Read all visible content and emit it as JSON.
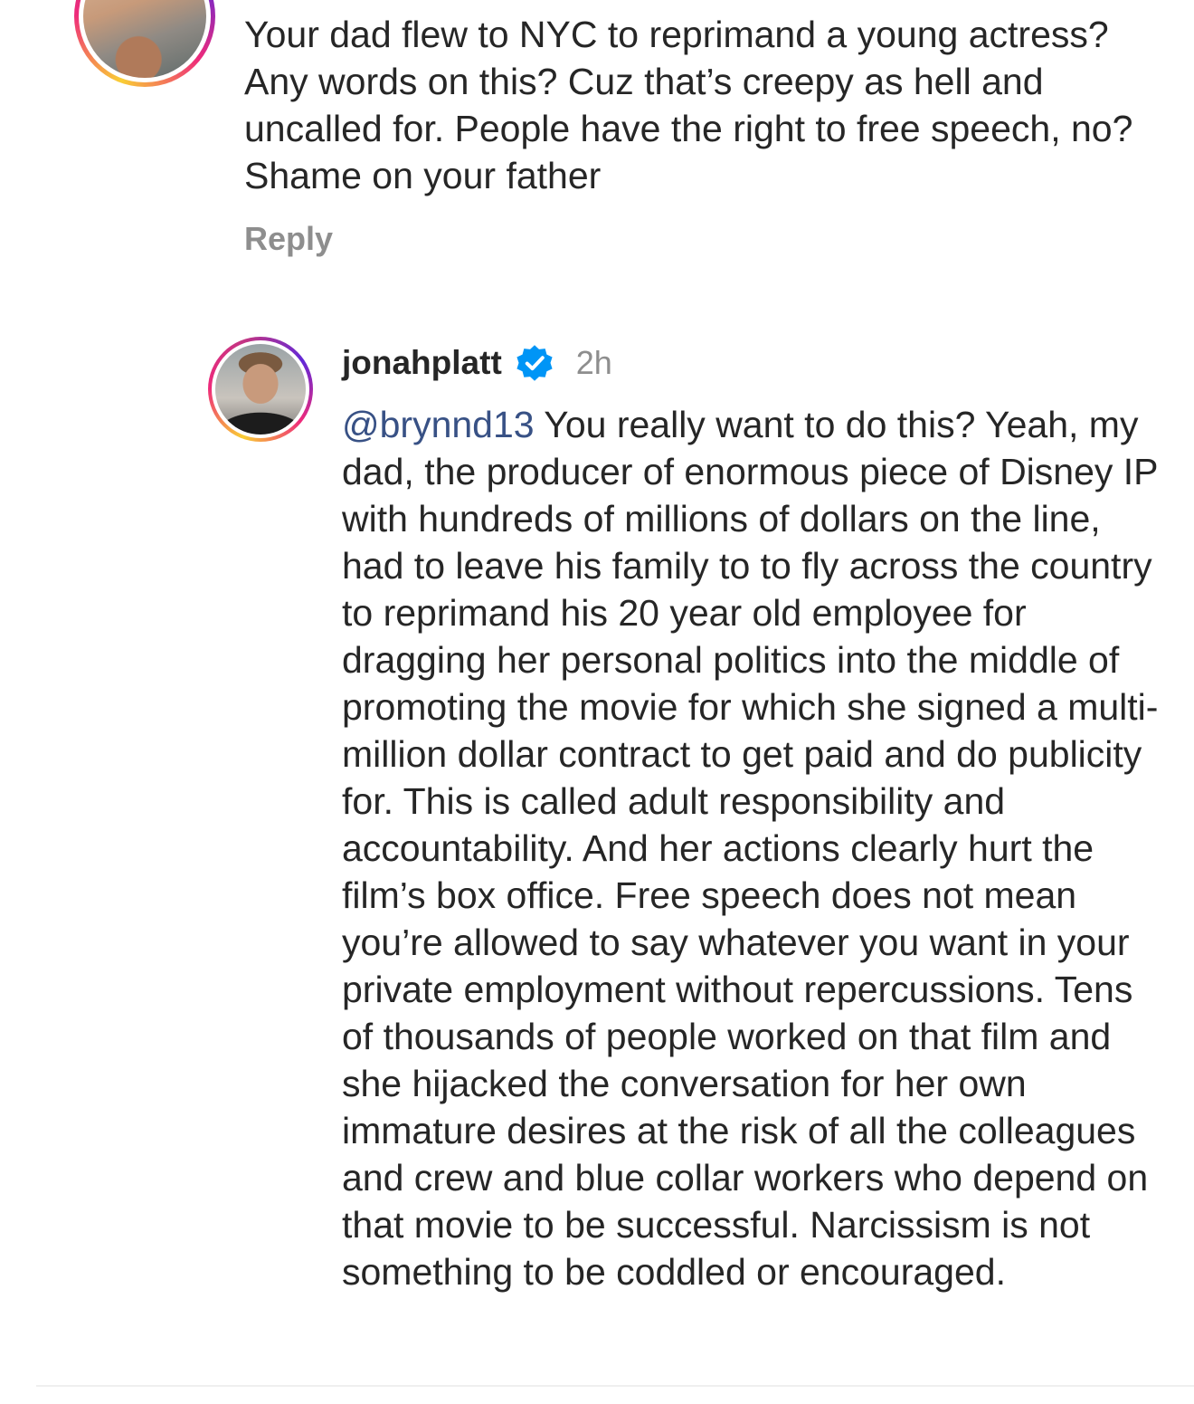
{
  "top_comment": {
    "text": "Your dad flew to NYC to reprimand a young actress? Any words on this? Cuz that’s creepy as hell and uncalled for. People have the right to free speech, no? Shame on your father",
    "reply_label": "Reply"
  },
  "reply_comment": {
    "username": "jonahplatt",
    "verified": true,
    "timestamp": "2h",
    "mention": "@brynnd13",
    "text": " You really want to do this? Yeah, my dad, the producer of enormous piece of Disney IP with hundreds of millions of dollars on the line, had to leave his family to to fly across the country to reprimand his 20 year old employee for dragging her personal politics into the middle of promoting the movie for which she signed a multi-million dollar contract to get paid and do publicity for. This is called adult responsibility and accountability. And her actions clearly hurt the film’s box office. Free speech does not mean you’re allowed to say whatever you want in your private employment without repercussions. Tens of thousands of people worked on that film and she hijacked the conversation for her own immature desires at the risk of all the colleagues and crew and blue collar workers who depend on that movie to be successful. Narcissism is not something to be coddled or encouraged."
  },
  "icons": {
    "verified": "verified-badge-icon"
  },
  "colors": {
    "text": "#262626",
    "muted": "#8e8e8e",
    "mention": "#385185",
    "verified_blue": "#0095f6"
  }
}
